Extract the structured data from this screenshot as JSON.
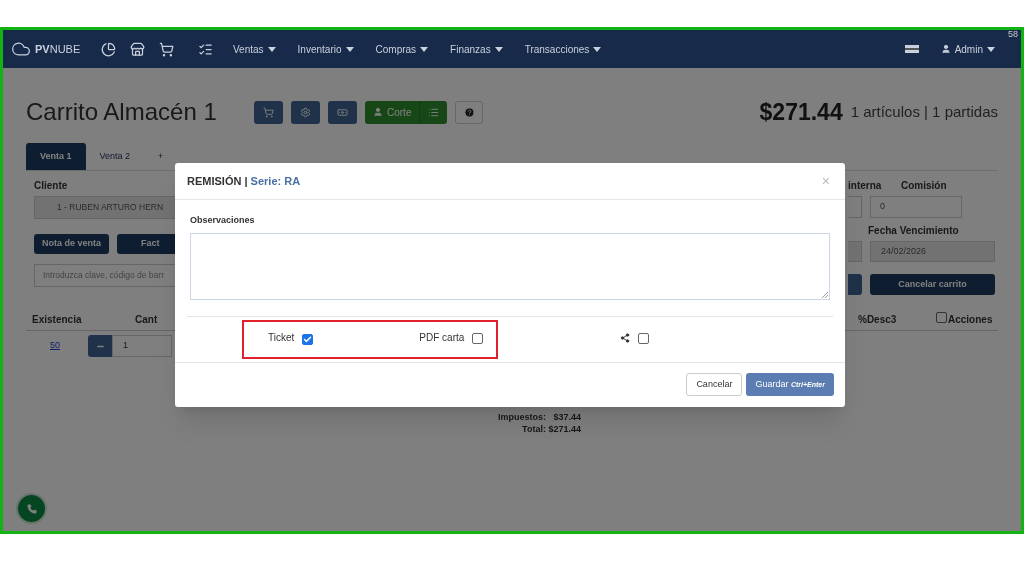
{
  "corner_number": "58",
  "navbar": {
    "brand": "PVNUBE",
    "menus": [
      "Ventas",
      "Inventario",
      "Compras",
      "Finanzas",
      "Transacciones"
    ],
    "user": "Admin"
  },
  "page": {
    "title": "Carrito Almacén 1",
    "corte_label": "Corte",
    "total": "$271.44",
    "summary": "1 artículos | 1 partidas",
    "tabs": [
      {
        "label": "Venta 1",
        "selected": true
      },
      {
        "label": "Venta 2",
        "selected": false
      },
      {
        "label": "+",
        "selected": false
      }
    ],
    "client_label": "Cliente",
    "client_value": "1 - RUBEN ARTURO HERN",
    "interna_label": "interna",
    "commission_label": "Comisión",
    "commission_value": "0",
    "due_label": "Fecha Vencimiento",
    "due_value": "24/02/2026",
    "buttons": [
      "Nota de venta",
      "Fact"
    ],
    "cancel_cart": "Cancelar carrito",
    "search_placeholder": "Introduzca clave, código de barr",
    "columns": [
      "Existencia",
      "Cant",
      "%Desc3",
      "Acciones"
    ],
    "actions_checked": false,
    "row": {
      "stock": "50",
      "qty": "1"
    },
    "taxes_label": "Impuestos:",
    "taxes_value": "$37.44",
    "total_label": "Total:",
    "total_value": "$271.44"
  },
  "modal": {
    "title": "REMISIÓN",
    "separator": "|",
    "series": "Serie: RA",
    "close": "×",
    "observations_label": "Observaciones",
    "options": [
      {
        "kind": "labeled",
        "label": "Ticket",
        "checked": true
      },
      {
        "kind": "labeled",
        "label": "PDF carta",
        "checked": false
      },
      {
        "kind": "share",
        "checked": false
      }
    ],
    "cancel": "Cancelar",
    "save": "Guardar",
    "save_shortcut": "Ctrl+Enter"
  }
}
